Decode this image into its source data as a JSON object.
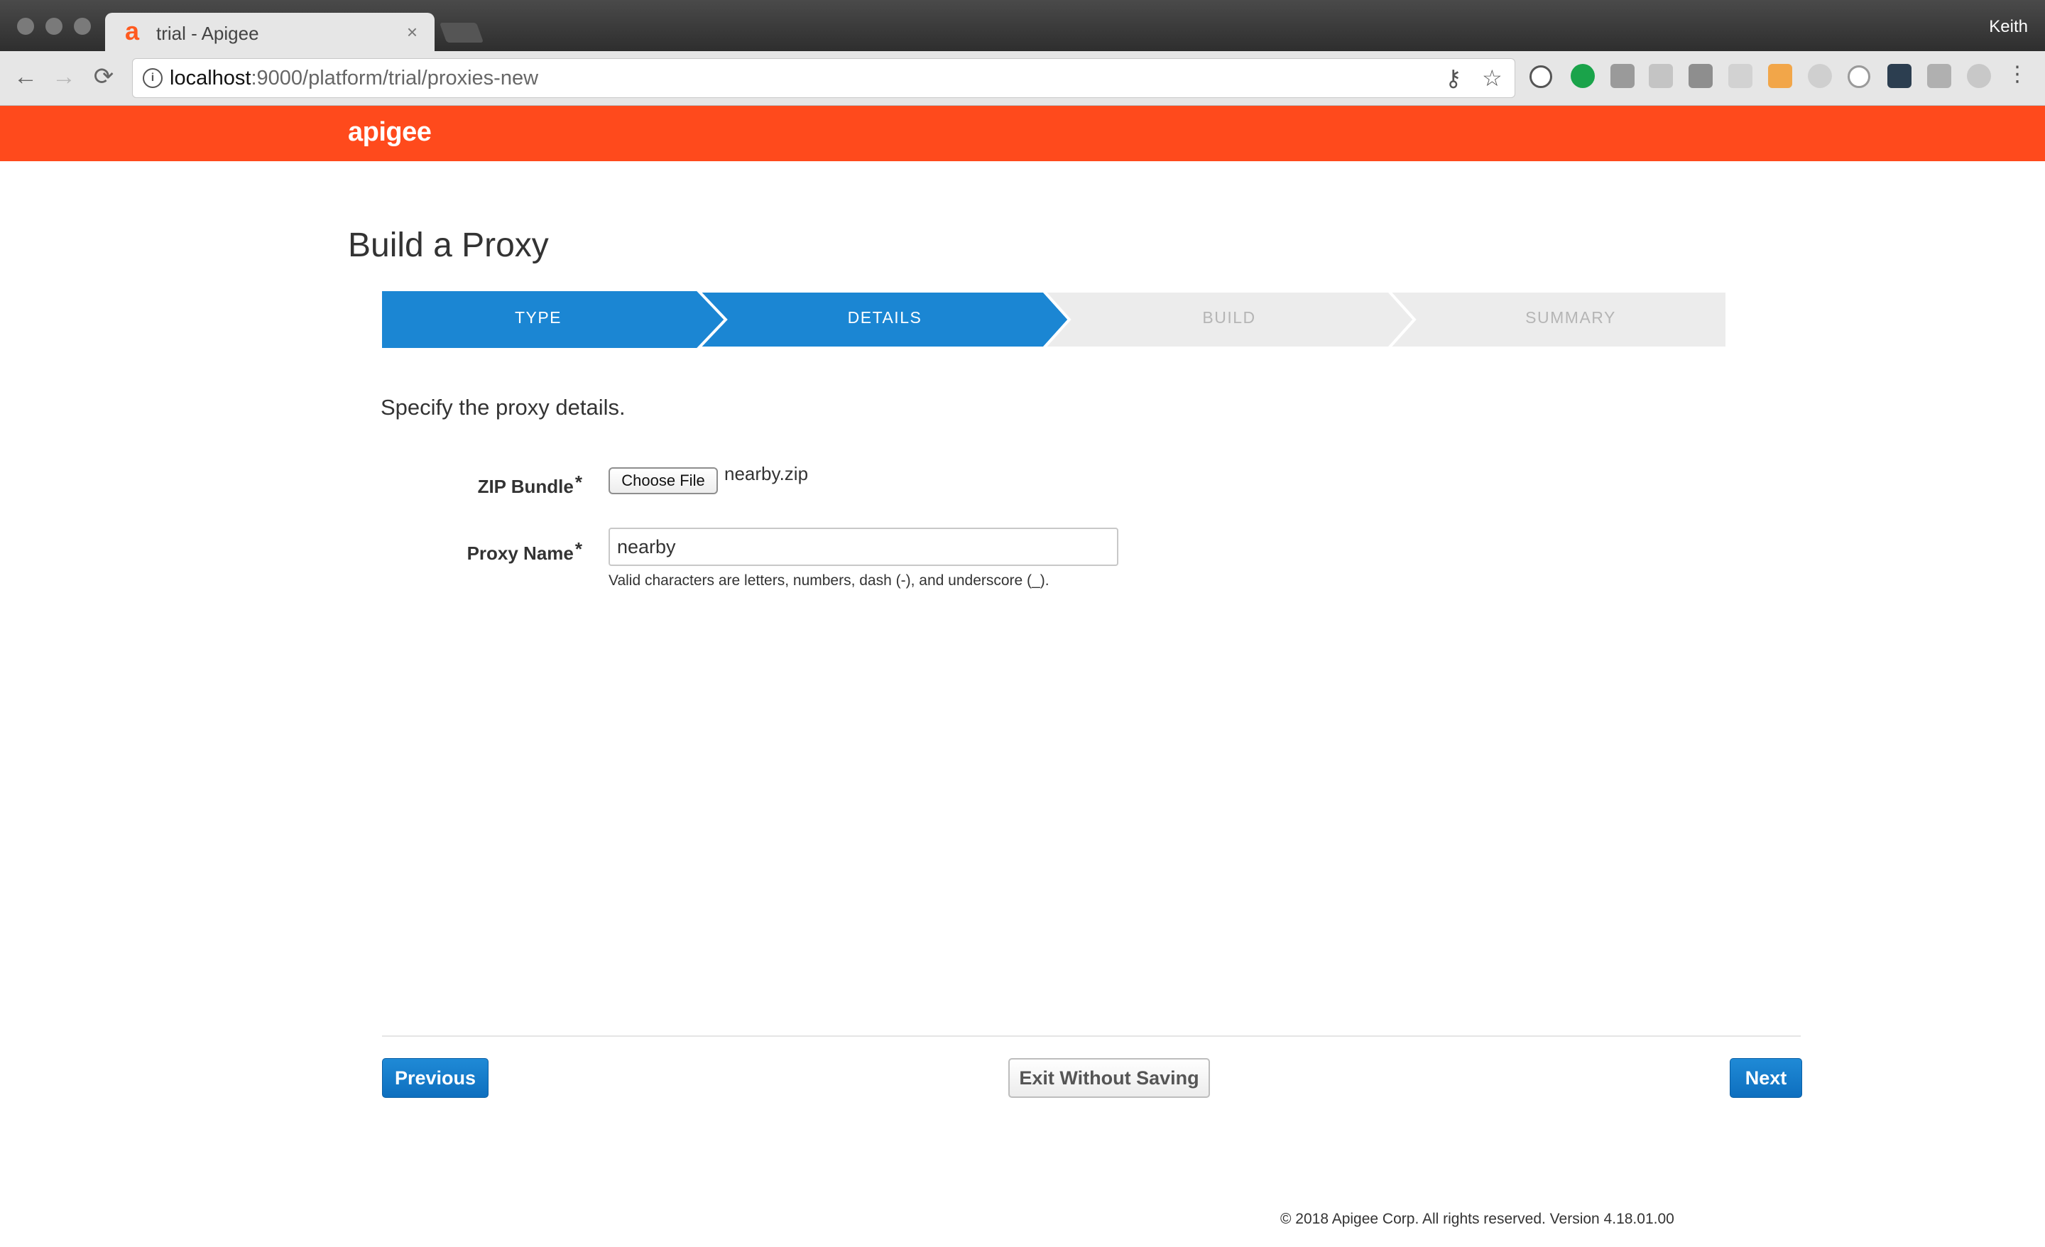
{
  "browser": {
    "tab_title": "trial - Apigee",
    "tab_close": "×",
    "profile_name": "Keith",
    "url_host": "localhost",
    "url_rest": ":9000/platform/trial/proxies-new",
    "nav": {
      "back": "←",
      "forward": "→",
      "reload": "⟳"
    },
    "omnibox_icons": {
      "key": "⚷",
      "star": "☆"
    }
  },
  "app": {
    "logo": "apigee",
    "brand_color": "#ff4a1c",
    "accent_color": "#1b86d3"
  },
  "page": {
    "title": "Build a Proxy",
    "instructions": "Specify the proxy details."
  },
  "wizard": {
    "steps": [
      {
        "label": "TYPE",
        "state": "complete"
      },
      {
        "label": "DETAILS",
        "state": "active"
      },
      {
        "label": "BUILD",
        "state": "inactive"
      },
      {
        "label": "SUMMARY",
        "state": "inactive"
      }
    ]
  },
  "form": {
    "zip_bundle": {
      "label": "ZIP Bundle",
      "required_mark": "*",
      "button_label": "Choose File",
      "file_name": "nearby.zip"
    },
    "proxy_name": {
      "label": "Proxy Name",
      "required_mark": "*",
      "value": "nearby",
      "help": "Valid characters are letters, numbers, dash (-), and underscore (_)."
    }
  },
  "actions": {
    "previous": "Previous",
    "exit": "Exit Without Saving",
    "next": "Next"
  },
  "footer": {
    "text": "© 2018 Apigee Corp. All rights reserved. Version 4.18.01.00"
  }
}
